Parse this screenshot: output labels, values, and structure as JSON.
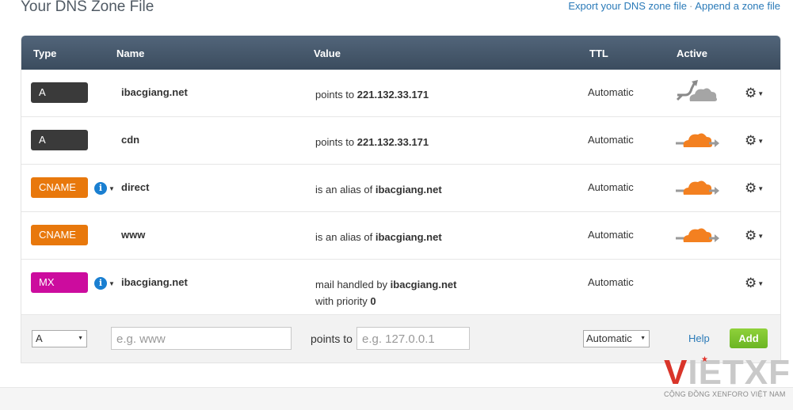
{
  "page": {
    "title": "Your DNS Zone File",
    "export_link": "Export your DNS zone file",
    "separator": "·",
    "append_link": "Append a zone file"
  },
  "table": {
    "headers": {
      "type": "Type",
      "name": "Name",
      "value": "Value",
      "ttl": "TTL",
      "active": "Active"
    },
    "rows": [
      {
        "type": "A",
        "type_color": "#3a3a3a",
        "info": false,
        "name": "ibacgiang.net",
        "value_prefix": "points to ",
        "value_bold": "221.132.33.171",
        "value_line2": "",
        "value_line2_bold": "",
        "ttl": "Automatic",
        "cloud": "grey-bypass"
      },
      {
        "type": "A",
        "type_color": "#3a3a3a",
        "info": false,
        "name": "cdn",
        "value_prefix": "points to ",
        "value_bold": "221.132.33.171",
        "value_line2": "",
        "value_line2_bold": "",
        "ttl": "Automatic",
        "cloud": "orange-active"
      },
      {
        "type": "CNAME",
        "type_color": "#e8780c",
        "info": true,
        "name": "direct",
        "value_prefix": "is an alias of ",
        "value_bold": "ibacgiang.net",
        "value_line2": "",
        "value_line2_bold": "",
        "ttl": "Automatic",
        "cloud": "orange-active"
      },
      {
        "type": "CNAME",
        "type_color": "#e8780c",
        "info": false,
        "name": "www",
        "value_prefix": "is an alias of ",
        "value_bold": "ibacgiang.net",
        "value_line2": "",
        "value_line2_bold": "",
        "ttl": "Automatic",
        "cloud": "orange-active"
      },
      {
        "type": "MX",
        "type_color": "#cc0c9e",
        "info": true,
        "name": "ibacgiang.net",
        "value_prefix": "mail handled by ",
        "value_bold": "ibacgiang.net",
        "value_line2": "with priority ",
        "value_line2_bold": "0",
        "ttl": "Automatic",
        "cloud": "none"
      }
    ]
  },
  "add_form": {
    "type_value": "A",
    "name_placeholder": "e.g. www",
    "points_label": "points to",
    "ip_placeholder": "e.g. 127.0.0.1",
    "ttl_value": "Automatic",
    "help_label": "Help",
    "add_label": "Add"
  },
  "watermark": {
    "logo_v": "V",
    "logo_rest": "IETXF",
    "tagline": "CỘNG ĐỒNG XENFORO VIỆT NAM"
  },
  "colors": {
    "header_bg": "#465869",
    "link": "#2a7ab8",
    "add_button": "#7cc22f",
    "cloud_orange": "#f38020",
    "cloud_grey": "#9a9a9a"
  }
}
